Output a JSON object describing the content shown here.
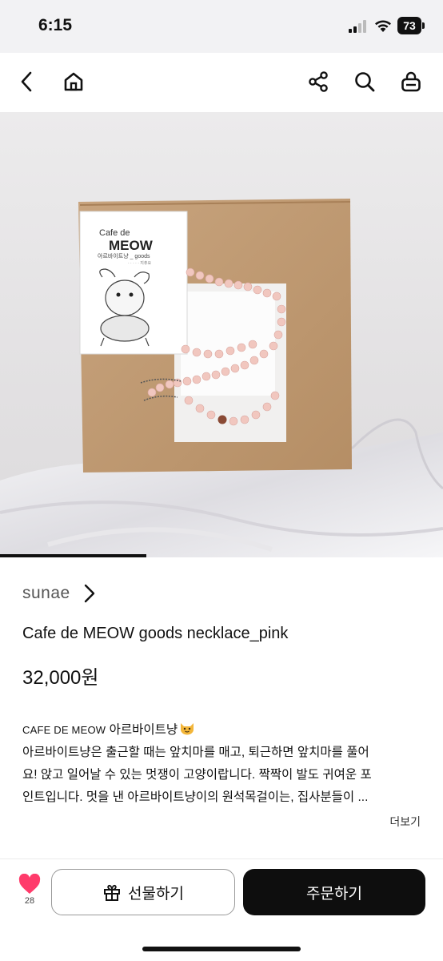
{
  "status_bar": {
    "time": "6:15",
    "battery": "73"
  },
  "nav": {
    "icons": [
      "back-icon",
      "home-icon",
      "share-icon",
      "search-icon",
      "cart-icon"
    ]
  },
  "image": {
    "sticker_title_small": "Cafe de",
    "sticker_title_big": "MEOW",
    "sticker_subtitle": "아르바이트냥 _ goods",
    "sticker_small": "· · · · · 지츄요",
    "carousel_progress": 0.33
  },
  "product": {
    "seller": "sunae",
    "title": "Cafe de MEOW goods necklace_pink",
    "price": "32,000원"
  },
  "description": {
    "brand": "CAFE DE MEOW",
    "heading": "아르바이트냥",
    "line1": "아르바이트냥은 출근할 때는 앞치마를 매고, 퇴근하면 앞치마를 풀어",
    "line2": "요! 앉고 일어날 수 있는 멋쟁이 고양이랍니다. 짝짝이 발도 귀여운 포",
    "line3": "인트입니다. 멋을 낸 아르바이트냥이의 원석목걸이는, 집사분들이 ...",
    "more": "더보기"
  },
  "bottom": {
    "like_count": "28",
    "gift_label": "선물하기",
    "order_label": "주문하기"
  },
  "colors": {
    "accent": "#ff3b6b",
    "primary_button": "#0e0e0e"
  }
}
